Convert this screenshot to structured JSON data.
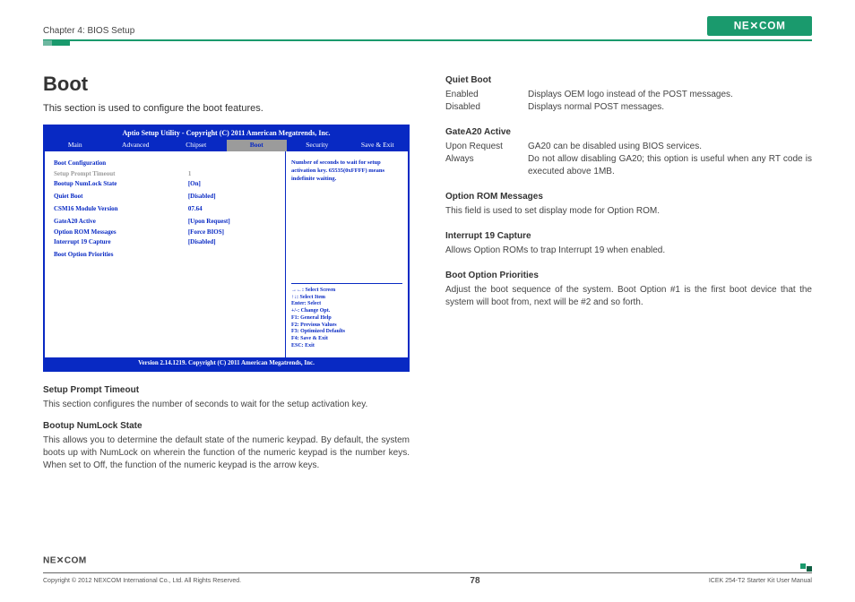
{
  "header": {
    "chapter": "Chapter 4: BIOS Setup",
    "logo_text": "NEXCOM"
  },
  "h1": "Boot",
  "intro": "This section is used to configure the boot features.",
  "bios": {
    "title": "Aptio Setup Utility - Copyright (C) 2011 American Megatrends, Inc.",
    "tabs": [
      "Main",
      "Advanced",
      "Chipset",
      "Boot",
      "Security",
      "Save & Exit"
    ],
    "active_tab": "Boot",
    "left_items": [
      {
        "label": "Boot Configuration",
        "value": "",
        "class": "blue"
      },
      {
        "label": "Setup Prompt Timeout",
        "value": "1",
        "class": "grey"
      },
      {
        "label": "Bootup NumLock State",
        "value": "[On]",
        "class": "blue"
      },
      {
        "label": "",
        "value": "",
        "class": ""
      },
      {
        "label": "Quiet Boot",
        "value": "[Disabled]",
        "class": "blue"
      },
      {
        "label": "",
        "value": "",
        "class": ""
      },
      {
        "label": "CSM16 Module Version",
        "value": "07.64",
        "class": "blue"
      },
      {
        "label": "",
        "value": "",
        "class": ""
      },
      {
        "label": "GateA20 Active",
        "value": "[Upon Request]",
        "class": "blue"
      },
      {
        "label": "Option ROM Messages",
        "value": "[Force BIOS]",
        "class": "blue"
      },
      {
        "label": "Interrupt 19 Capture",
        "value": "[Disabled]",
        "class": "blue"
      },
      {
        "label": "",
        "value": "",
        "class": ""
      },
      {
        "label": "Boot Option Priorities",
        "value": "",
        "class": "blue"
      }
    ],
    "right_help_top": "Number of seconds to wait for setup activation key. 65535(0xFFFF) means indefinite waiting.",
    "right_help_keys": [
      "→←: Select Screen",
      "↑↓: Select Item",
      "Enter: Select",
      "+/-: Change Opt.",
      "F1: General Help",
      "F2: Previous Values",
      "F3: Optimized Defaults",
      "F4: Save & Exit",
      "ESC: Exit"
    ],
    "footer": "Version 2.14.1219. Copyright (C) 2011 American Megatrends, Inc."
  },
  "left_sections": [
    {
      "title": "Setup Prompt Timeout",
      "body": "This section configures the number of seconds to wait for the setup activation key."
    },
    {
      "title": "Bootup NumLock State",
      "body": "This allows you to determine the default state of the numeric keypad. By default, the system boots up with NumLock on wherein the function of the numeric keypad is the number keys. When set to Off, the function of the numeric keypad is the arrow keys."
    }
  ],
  "right_sections": [
    {
      "title": "Quiet Boot",
      "defs": [
        {
          "term": "Enabled",
          "desc": "Displays OEM logo instead of the POST messages."
        },
        {
          "term": "Disabled",
          "desc": "Displays normal POST messages."
        }
      ]
    },
    {
      "title": "GateA20 Active",
      "defs": [
        {
          "term": "Upon Request",
          "desc": "GA20 can be disabled using BIOS services."
        },
        {
          "term": "Always",
          "desc": "Do not allow disabling GA20; this option is useful when any RT code is executed above 1MB."
        }
      ]
    },
    {
      "title": "Option ROM Messages",
      "body": "This field is used to set display mode for Option ROM."
    },
    {
      "title": "Interrupt 19 Capture",
      "body": "Allows Option ROMs to trap Interrupt 19 when enabled."
    },
    {
      "title": "Boot Option Priorities",
      "body": "Adjust the boot sequence of the system. Boot Option #1 is the first boot device that the system will boot from, next will be #2 and so forth."
    }
  ],
  "footer": {
    "copyright": "Copyright © 2012 NEXCOM International Co., Ltd. All Rights Reserved.",
    "page": "78",
    "manual": "ICEK 254-T2 Starter Kit User Manual"
  }
}
